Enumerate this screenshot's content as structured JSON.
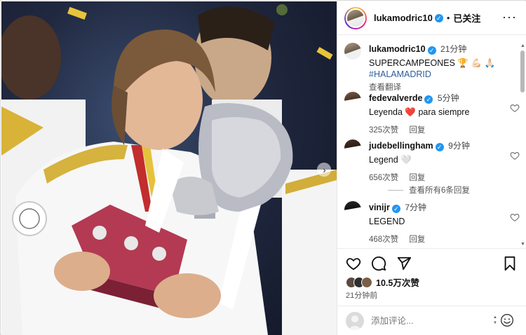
{
  "post": {
    "username": "lukamodric10",
    "follow_state": "已关注",
    "separator": "•",
    "more_label": "···",
    "caption": {
      "username": "lukamodric10",
      "time": "21分钟",
      "text": "SUPERCAMPEONES 🏆 💪🏻 🙏🏻",
      "hashtag": "#HALAMADRID",
      "translate": "查看翻译"
    },
    "comments": [
      {
        "username": "fedevalverde",
        "time": "5分钟",
        "text": "Leyenda ❤️ para siempre",
        "likes": "325次赞",
        "reply": "回复",
        "verified": true
      },
      {
        "username": "judebellingham",
        "time": "9分钟",
        "text": "Legend 🤍",
        "likes": "656次赞",
        "reply": "回复",
        "verified": true
      },
      {
        "username": "vinijr",
        "time": "7分钟",
        "text": "LEGEND",
        "likes": "468次赞",
        "reply": "回复",
        "verified": true
      }
    ],
    "view_replies": "查看所有6条回复",
    "likes_text": "10.5万次赞",
    "posted_ago": "21分钟前",
    "comment_placeholder": "添加评论...",
    "verified_mark": "✓"
  },
  "icons": {
    "like": "heart-icon",
    "comment": "comment-icon",
    "share": "share-icon",
    "save": "bookmark-icon",
    "more": "more-icon",
    "emoji": "emoji-icon",
    "next": "chevron-right-icon"
  },
  "colors": {
    "verified": "#2196f3",
    "hashtag": "#2d5c9a",
    "heart": "#e0245e"
  }
}
